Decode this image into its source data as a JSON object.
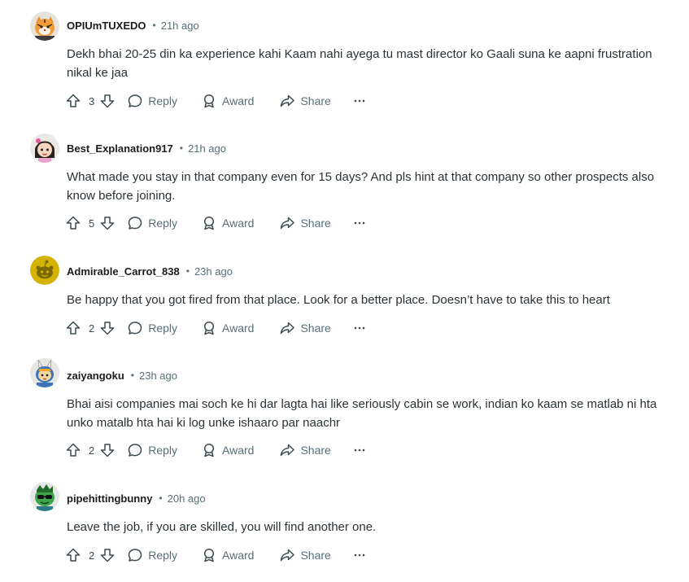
{
  "comments": [
    {
      "username": "OPIUmTUXEDO",
      "time": "21h ago",
      "body_lines": [
        "Dekh bhai 20-25 din ka experience kahi Kaam nahi ayega tu mast director ko Gaali suna ke aapni frustration",
        "nikal ke jaa"
      ],
      "score": "3",
      "avatar": "tiger-snoo-avatar"
    },
    {
      "username": "Best_Explanation917",
      "time": "21h ago",
      "body_lines": [
        "What made you stay in that company even for 15 days? And pls hint at that company so other prospects also",
        "know before joining."
      ],
      "score": "5",
      "avatar": "girl-snoo-avatar"
    },
    {
      "username": "Admirable_Carrot_838",
      "time": "23h ago",
      "body_lines": [
        "Be happy that you got fired from that place. Look for a better place. Doesn’t have to take this to heart"
      ],
      "score": "2",
      "avatar": "default-yellow-snoo-avatar"
    },
    {
      "username": "zaiyangoku",
      "time": "23h ago",
      "body_lines": [
        "Bhai aisi companies mai soch ke hi dar lagta hai like seriously cabin se work, indian ko kaam se matlab ni hta",
        "unko matalb hta hai ki log unke ishaaro par naachr"
      ],
      "score": "2",
      "avatar": "bunny-ears-snoo-avatar"
    },
    {
      "username": "pipehittingbunny",
      "time": "20h ago",
      "body_lines": [
        "Leave the job, if you are skilled, you will find another one."
      ],
      "score": "2",
      "avatar": "green-sunglasses-snoo-avatar"
    }
  ],
  "labels": {
    "separator": "•",
    "reply": "Reply",
    "award": "Award",
    "share": "Share"
  },
  "colors": {
    "meta": "#576f76",
    "body": "#2a3236",
    "username": "#1c1c1c"
  }
}
